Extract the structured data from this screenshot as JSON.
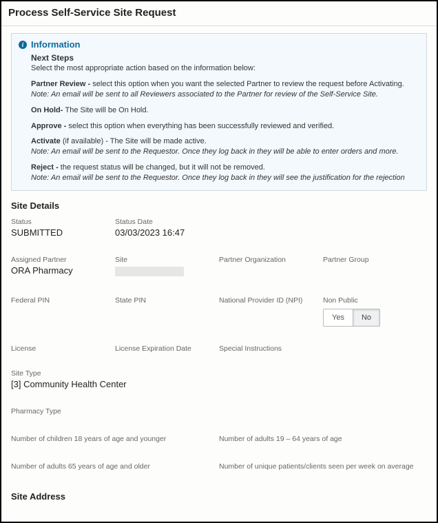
{
  "header": {
    "title": "Process Self-Service Site Request"
  },
  "info": {
    "title": "Information",
    "heading": "Next Steps",
    "intro": "Select the most appropriate action based on the information below:",
    "partner_review_label": "Partner Review - ",
    "partner_review_text": "select this option when you want the selected Partner to review the request before Activating.",
    "partner_review_note": "Note: An email will be sent to all Reviewers associated to the Partner for review of the Self-Service Site.",
    "onhold_label": "On Hold- ",
    "onhold_text": "The Site will be On Hold.",
    "approve_label": "Approve - ",
    "approve_text": "select this option when everything has been successfully reviewed and verified.",
    "activate_label": "Activate ",
    "activate_paren": "(if available) - ",
    "activate_text": "The Site will be made active.",
    "activate_note": "Note: An email will be sent to the Requestor. Once they log back in they will be able to enter orders and more.",
    "reject_label": "Reject - ",
    "reject_text": "the request status will be changed, but it will not be removed.",
    "reject_note": "Note: An email will be sent to the Requestor. Once they log back in they will see the justification for the rejection"
  },
  "sections": {
    "site_details": "Site Details",
    "site_address": "Site Address"
  },
  "labels": {
    "status": "Status",
    "status_date": "Status Date",
    "assigned_partner": "Assigned Partner",
    "site": "Site",
    "partner_org": "Partner Organization",
    "partner_group": "Partner Group",
    "federal_pin": "Federal PIN",
    "state_pin": "State PIN",
    "npi": "National Provider ID (NPI)",
    "non_public": "Non Public",
    "license": "License",
    "license_exp": "License Expiration Date",
    "special": "Special Instructions",
    "site_type": "Site Type",
    "pharmacy_type": "Pharmacy Type",
    "children": "Number of children 18 years of age and younger",
    "adults_19_64": "Number of adults 19 – 64 years of age",
    "adults_65": "Number of adults 65 years of age and older",
    "unique": "Number of unique patients/clients seen per week on average"
  },
  "values": {
    "status": "SUBMITTED",
    "status_date": "03/03/2023 16:47",
    "assigned_partner": "ORA Pharmacy",
    "site_type": "[3] Community Health Center",
    "non_public_yes": "Yes",
    "non_public_no": "No"
  }
}
